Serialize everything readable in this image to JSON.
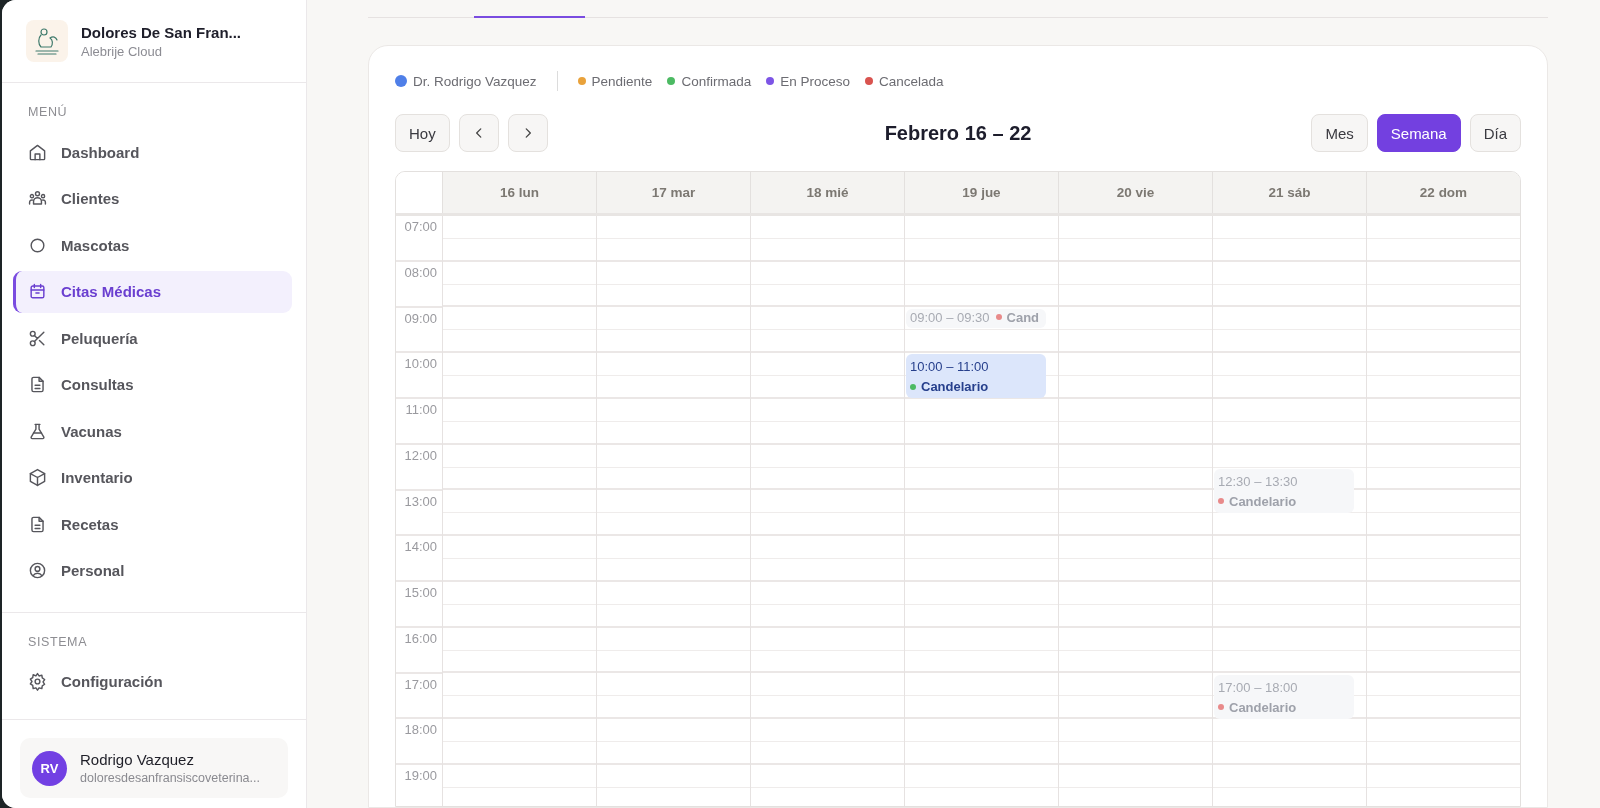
{
  "sidebar": {
    "clinic_name": "Dolores De San Fran...",
    "clinic_subtitle": "Alebrije Cloud",
    "sections": [
      {
        "title": "MENÚ",
        "items": [
          {
            "label": "Dashboard",
            "selected": false
          },
          {
            "label": "Clientes",
            "selected": false
          },
          {
            "label": "Mascotas",
            "selected": false
          },
          {
            "label": "Citas Médicas",
            "selected": true
          },
          {
            "label": "Peluquería",
            "selected": false
          },
          {
            "label": "Consultas",
            "selected": false
          },
          {
            "label": "Vacunas",
            "selected": false
          },
          {
            "label": "Inventario",
            "selected": false
          },
          {
            "label": "Recetas",
            "selected": false
          },
          {
            "label": "Personal",
            "selected": false
          }
        ]
      },
      {
        "title": "SISTEMA",
        "items": [
          {
            "label": "Configuración",
            "selected": false
          }
        ]
      }
    ],
    "user": {
      "initials": "RV",
      "name": "Rodrigo Vazquez",
      "email": "doloresdesanfransiscoveterina..."
    }
  },
  "calendar": {
    "legend": {
      "doctor": {
        "label": "Dr. Rodrigo Vazquez",
        "color": "#4f7fe8"
      },
      "statuses": [
        {
          "label": "Pendiente",
          "color": "#e9a23b"
        },
        {
          "label": "Confirmada",
          "color": "#4cba63"
        },
        {
          "label": "En Proceso",
          "color": "#7d55e6"
        },
        {
          "label": "Cancelada",
          "color": "#d9534f"
        }
      ]
    },
    "today_button": "Hoy",
    "title": "Febrero 16 – 22",
    "views": [
      {
        "label": "Mes",
        "selected": false
      },
      {
        "label": "Semana",
        "selected": true
      },
      {
        "label": "Día",
        "selected": false
      }
    ],
    "hours": [
      "07:00",
      "08:00",
      "09:00",
      "10:00",
      "11:00",
      "12:00",
      "13:00",
      "14:00",
      "15:00",
      "16:00",
      "17:00",
      "18:00",
      "19:00"
    ],
    "days": [
      {
        "label": "16 lun"
      },
      {
        "label": "17 mar"
      },
      {
        "label": "18 mié"
      },
      {
        "label": "19 jue",
        "events": [
          {
            "kind": "inline",
            "time": "09:00 – 09:30",
            "name": "Cand",
            "cancelled": true,
            "color": "#e88a8a"
          },
          {
            "kind": "block",
            "time": "10:00 – 11:00",
            "name": "Candelario",
            "cancelled": false,
            "color": "#4cba63"
          }
        ]
      },
      {
        "label": "20 vie"
      },
      {
        "label": "21 sáb",
        "events": [
          {
            "kind": "block",
            "time": "12:30 – 13:30",
            "name": "Candelario",
            "cancelled": true,
            "color": "#e88a8a"
          },
          {
            "kind": "block",
            "time": "17:00 – 18:00",
            "name": "Candelario",
            "cancelled": true,
            "color": "#e88a8a"
          }
        ]
      },
      {
        "label": "22 dom"
      }
    ]
  }
}
